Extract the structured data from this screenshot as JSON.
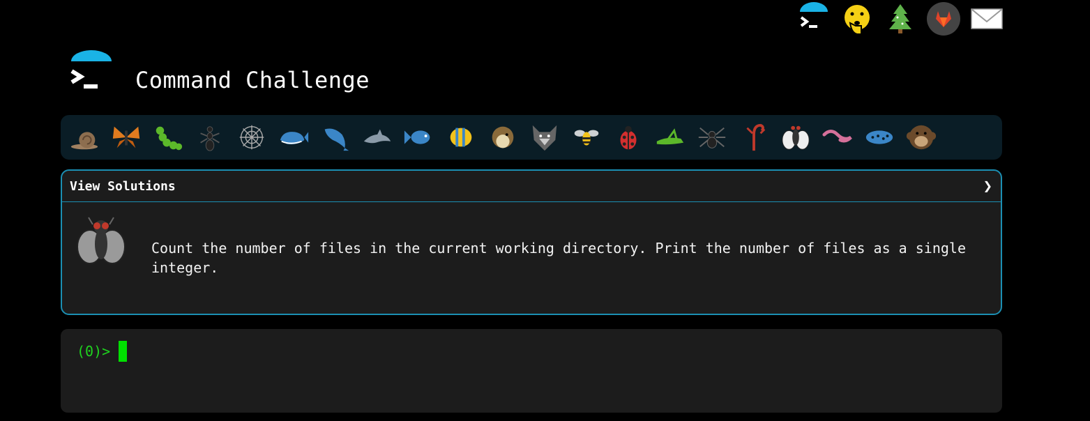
{
  "header": {
    "title": "Command Challenge"
  },
  "top_icons": [
    "terminal-icon",
    "shush-emoji-icon",
    "tree-icon",
    "gitlab-icon",
    "mail-icon"
  ],
  "animals": [
    "snail",
    "butterfly",
    "caterpillar",
    "ant",
    "spider-web",
    "whale",
    "whale-2",
    "dolphin",
    "fish",
    "tropical-fish",
    "blowfish",
    "wolf",
    "bee",
    "ladybug",
    "cricket",
    "spider",
    "scorpion",
    "fly",
    "worm",
    "microbe",
    "monkey"
  ],
  "panel": {
    "header_label": "View Solutions",
    "chevron": "❯",
    "task": "Count the number of files in the current working directory. Print the number of files as a single integer."
  },
  "terminal": {
    "prompt": "(0)>"
  },
  "colors": {
    "accent": "#1b8fb3",
    "logo_blue": "#1ab3e6",
    "prompt_green": "#1fd41f",
    "panel_bg": "#1c1c1c",
    "strip_bg": "#0a1d26"
  }
}
